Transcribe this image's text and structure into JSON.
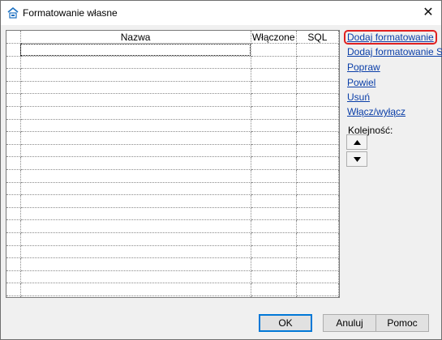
{
  "window": {
    "title": "Formatowanie własne",
    "close_glyph": "✕",
    "icon": "db-icon"
  },
  "grid": {
    "columns": [
      "",
      "Nazwa",
      "Włączone",
      "SQL"
    ],
    "row_count": 21
  },
  "actions": {
    "add_formatting": "Dodaj formatowanie",
    "add_sql_formatting": "Dodaj formatowanie SQL",
    "edit": "Popraw",
    "duplicate": "Powiel",
    "delete": "Usuń",
    "toggle": "Włącz/wyłącz"
  },
  "order": {
    "label": "Kolejność:",
    "up_icon": "arrow-up-icon",
    "down_icon": "arrow-down-icon"
  },
  "footer": {
    "ok": "OK",
    "cancel": "Anuluj",
    "help": "Pomoc"
  },
  "colors": {
    "link": "#0a3ea8",
    "highlight": "#e02020",
    "default_button_border": "#0078d7"
  }
}
